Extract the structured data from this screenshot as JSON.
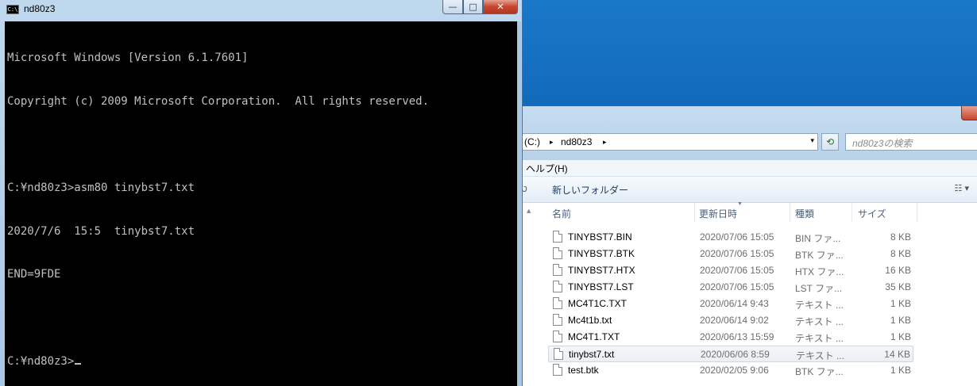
{
  "console": {
    "title": "nd80z3",
    "icon_text": "C:\\",
    "lines": [
      "Microsoft Windows [Version 6.1.7601]",
      "Copyright (c) 2009 Microsoft Corporation.  All rights reserved.",
      "",
      "C:¥nd80z3>asm80 tinybst7.txt",
      "2020/7/6  15:5  tinybst7.txt",
      "END=9FDE",
      "",
      "C:¥nd80z3>"
    ],
    "controls": {
      "minimize": "—",
      "maximize": "□",
      "close": "✕"
    }
  },
  "explorer": {
    "address": {
      "drive": "(C:)",
      "folder": "nd80z3",
      "sep": "▸",
      "dropdown": "▾"
    },
    "refresh_icon": "⟲",
    "search_placeholder": "nd80z3の検索",
    "menu_help": "ヘルプ(H)",
    "toolbar": {
      "back": "ט",
      "new_folder": "新しいフォルダー",
      "view": "☷ ▾"
    },
    "columns": {
      "name": "名前",
      "date": "更新日時",
      "type": "種類",
      "size": "サイズ"
    },
    "files": [
      {
        "name": "TINYBST7.BIN",
        "date": "2020/07/06 15:05",
        "type": "BIN ファ...",
        "size": "8 KB"
      },
      {
        "name": "TINYBST7.BTK",
        "date": "2020/07/06 15:05",
        "type": "BTK ファ...",
        "size": "8 KB"
      },
      {
        "name": "TINYBST7.HTX",
        "date": "2020/07/06 15:05",
        "type": "HTX ファ...",
        "size": "16 KB"
      },
      {
        "name": "TINYBST7.LST",
        "date": "2020/07/06 15:05",
        "type": "LST ファ...",
        "size": "35 KB"
      },
      {
        "name": "MC4T1C.TXT",
        "date": "2020/06/14 9:43",
        "type": "テキスト ...",
        "size": "1 KB"
      },
      {
        "name": "Mc4t1b.txt",
        "date": "2020/06/14 9:02",
        "type": "テキスト ...",
        "size": "1 KB"
      },
      {
        "name": "MC4T1.TXT",
        "date": "2020/06/13 15:59",
        "type": "テキスト ...",
        "size": "1 KB"
      },
      {
        "name": "tinybst7.txt",
        "date": "2020/06/06 8:59",
        "type": "テキスト ...",
        "size": "14 KB"
      },
      {
        "name": "test.btk",
        "date": "2020/02/05 9:06",
        "type": "BTK ファ...",
        "size": "1 KB"
      }
    ]
  }
}
